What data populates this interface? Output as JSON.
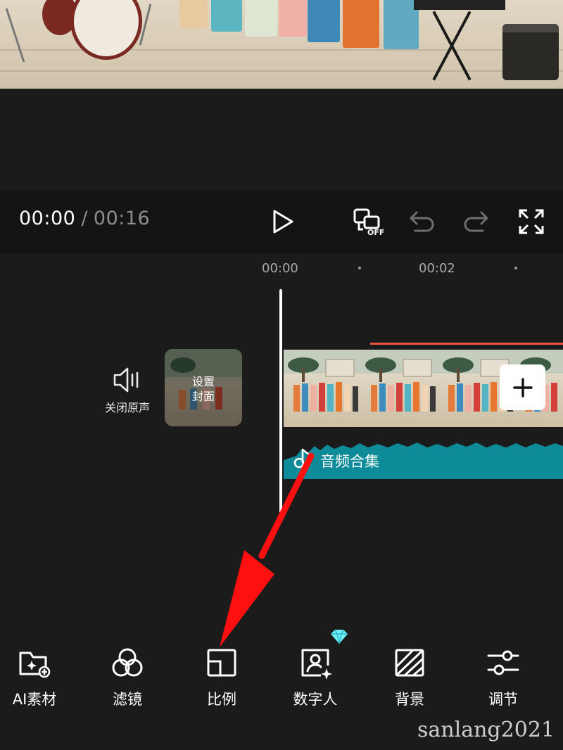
{
  "playback": {
    "current_time": "00:00",
    "separator": "/",
    "total_time": "00:16"
  },
  "ruler": {
    "mark_1": "00:00",
    "mark_2": "00:02"
  },
  "track_controls": {
    "mute_label": "关闭原声",
    "cover_label_line1": "设置",
    "cover_label_line2": "封面"
  },
  "audio_track": {
    "label": "音频合集",
    "color": "#0e8b98"
  },
  "toolbar": {
    "items": [
      {
        "label": "AI素材",
        "icon": "ai-material-icon"
      },
      {
        "label": "滤镜",
        "icon": "filter-icon"
      },
      {
        "label": "比例",
        "icon": "aspect-ratio-icon"
      },
      {
        "label": "数字人",
        "icon": "digital-human-icon"
      },
      {
        "label": "背景",
        "icon": "background-icon"
      },
      {
        "label": "调节",
        "icon": "adjust-icon"
      }
    ]
  },
  "icons": {
    "play": "play-icon",
    "sync_off": "sync-off-icon",
    "undo": "undo-icon",
    "redo": "redo-icon",
    "fullscreen": "fullscreen-icon",
    "speaker": "speaker-icon",
    "add": "add-icon",
    "note": "music-note-icon",
    "vip": "diamond-icon"
  },
  "colors": {
    "background": "#1b1b1b",
    "control_bar": "#141414",
    "clip_marker": "#f0533f",
    "annotation_arrow": "#ff1010"
  },
  "watermark": "sanlang2021"
}
